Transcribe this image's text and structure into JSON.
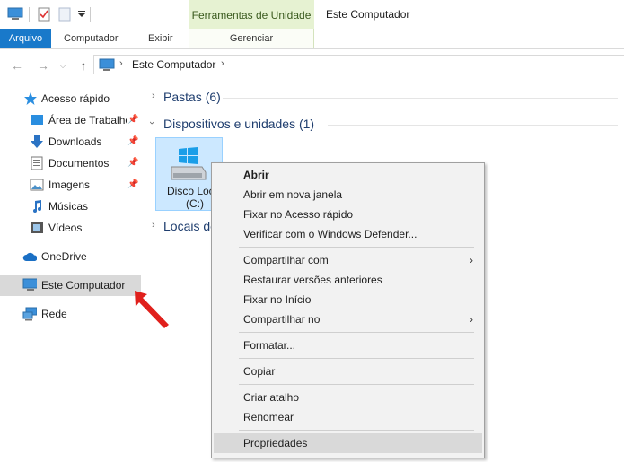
{
  "window": {
    "title": "Este Computador",
    "context_tab": "Ferramentas de Unidade"
  },
  "ribbon": {
    "tabs": [
      "Arquivo",
      "Computador",
      "Exibir",
      "Gerenciar"
    ]
  },
  "address": {
    "path": "Este Computador"
  },
  "sidebar": {
    "items": [
      {
        "label": "Acesso rápido",
        "icon": "star-icon"
      },
      {
        "label": "Área de Trabalho",
        "icon": "desktop-icon",
        "pinned": true
      },
      {
        "label": "Downloads",
        "icon": "download-arrow-icon",
        "pinned": true
      },
      {
        "label": "Documentos",
        "icon": "document-icon",
        "pinned": true
      },
      {
        "label": "Imagens",
        "icon": "pictures-icon",
        "pinned": true
      },
      {
        "label": "Músicas",
        "icon": "music-note-icon"
      },
      {
        "label": "Vídeos",
        "icon": "film-icon"
      },
      {
        "label": "OneDrive",
        "icon": "cloud-icon"
      },
      {
        "label": "Este Computador",
        "icon": "computer-icon",
        "selected": true
      },
      {
        "label": "Rede",
        "icon": "network-icon"
      }
    ]
  },
  "main": {
    "groups": [
      "Pastas (6)",
      "Dispositivos e unidades (1)",
      "Locais de rede"
    ],
    "drive": {
      "name": "Disco Local",
      "letter": "(C:)"
    }
  },
  "context_menu": {
    "items": [
      "Abrir",
      "Abrir em nova janela",
      "Fixar no Acesso rápido",
      "Verificar com o Windows Defender...",
      "Compartilhar com",
      "Restaurar versões anteriores",
      "Fixar no Início",
      "Compartilhar no",
      "Formatar...",
      "Copiar",
      "Criar atalho",
      "Renomear",
      "Propriedades"
    ]
  },
  "colors": {
    "accent": "#1979ca",
    "selection": "#cce8ff",
    "tool_tab": "#e6f2d2",
    "arrow": "#e0201c"
  }
}
